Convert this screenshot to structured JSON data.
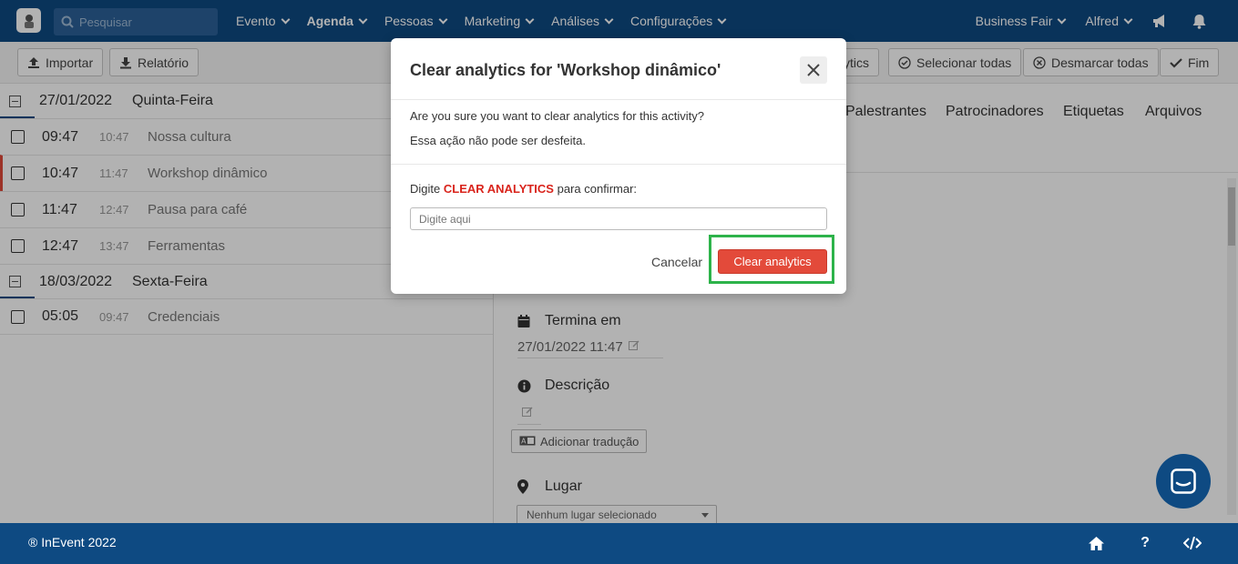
{
  "navbar": {
    "search_placeholder": "Pesquisar",
    "menu": [
      "Evento",
      "Agenda",
      "Pessoas",
      "Marketing",
      "Análises",
      "Configurações"
    ],
    "event_selector": "Business Fair",
    "user": "Alfred",
    "icons": [
      "megaphone-icon",
      "bell-icon"
    ]
  },
  "toolbar": {
    "import_label": "Importar",
    "report_label": "Relatório",
    "analytics_partial_label": "ytics",
    "select_all_label": "Selecionar todas",
    "deselect_all_label": "Desmarcar todas",
    "end_label": "Fim"
  },
  "agenda": {
    "days": [
      {
        "date": "27/01/2022",
        "weekday": "Quinta-Feira",
        "activities": [
          {
            "start": "09:47",
            "end": "10:47",
            "name": "Nossa cultura"
          },
          {
            "start": "10:47",
            "end": "11:47",
            "name": "Workshop dinâmico"
          },
          {
            "start": "11:47",
            "end": "12:47",
            "name": "Pausa para café"
          },
          {
            "start": "12:47",
            "end": "13:47",
            "name": "Ferramentas"
          }
        ]
      },
      {
        "date": "18/03/2022",
        "weekday": "Sexta-Feira",
        "activities": [
          {
            "start": "05:05",
            "end": "09:47",
            "name": "Credenciais"
          }
        ]
      }
    ]
  },
  "detail": {
    "tabs": [
      "Palestrantes",
      "Patrocinadores",
      "Etiquetas",
      "Arquivos"
    ],
    "ends_label": "Termina em",
    "ends_value": "27/01/2022 11:47",
    "description_label": "Descrição",
    "add_translation_label": "Adicionar tradução",
    "place_label": "Lugar",
    "place_value": "Nenhum lugar selecionado"
  },
  "modal": {
    "title": "Clear analytics for 'Workshop dinâmico'",
    "message": "Are you sure you want to clear analytics for this activity?",
    "warning": "Essa ação não pode ser desfeita.",
    "confirm_prefix": "Digite",
    "confirm_keyword": "CLEAR ANALYTICS",
    "confirm_suffix": "para confirmar:",
    "input_placeholder": "Digite aqui",
    "cancel_label": "Cancelar",
    "confirm_button_label": "Clear analytics",
    "highlight_color": "#2db34a",
    "danger_color": "#e34a3a"
  },
  "footer": {
    "copyright": "® InEvent 2022"
  },
  "colors": {
    "brand": "#0e4a82",
    "active_marker": "#e04a3a"
  }
}
